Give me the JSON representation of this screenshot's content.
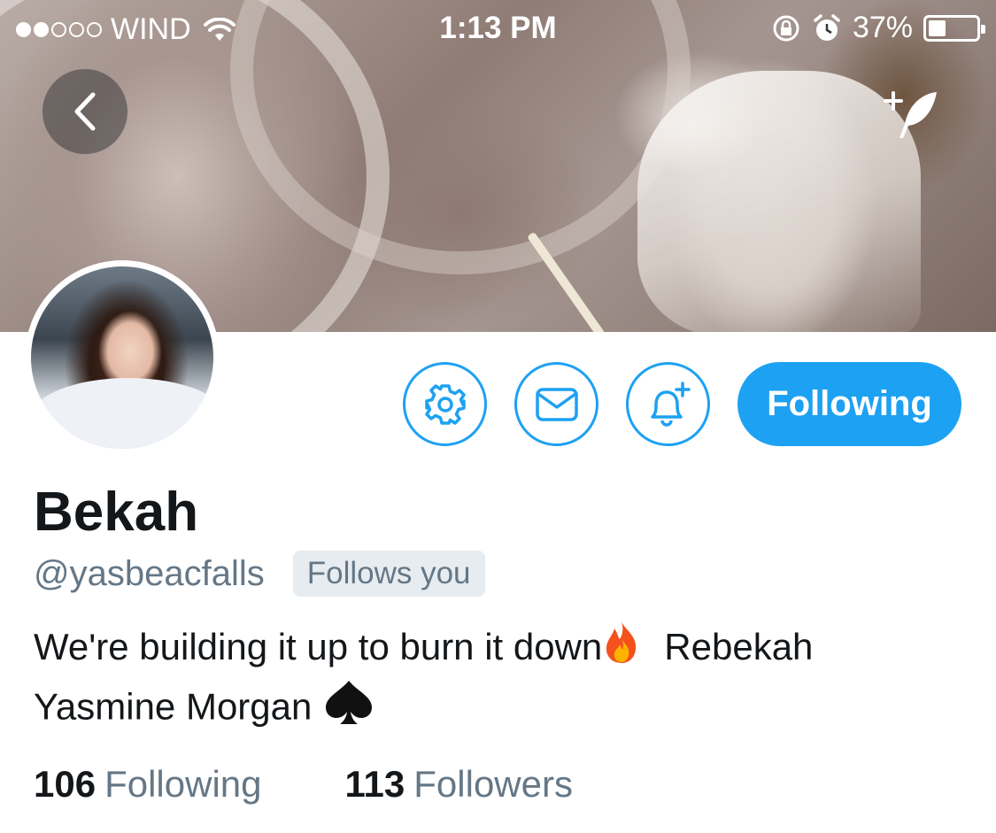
{
  "status_bar": {
    "carrier": "WIND",
    "time": "1:13 PM",
    "battery": "37%",
    "battery_level": 0.37,
    "signal_bars_filled": 2,
    "signal_bars_total": 5
  },
  "header": {
    "back_icon": "chevron-left-icon",
    "compose_icon": "compose-quill-icon"
  },
  "profile": {
    "name": "Bekah",
    "handle": "@yasbeacfalls",
    "follows_you": "Follows you",
    "bio_line1": "We're building it up to burn it down",
    "bio_line1_tail": "Rebekah",
    "bio_line2": "Yasmine Morgan",
    "bio_emojis": [
      "fire-emoji",
      "spade-emoji"
    ]
  },
  "actions": {
    "settings_icon": "gear-icon",
    "message_icon": "envelope-icon",
    "notify_icon": "bell-plus-icon",
    "follow_label": "Following"
  },
  "stats": {
    "following_count": "106",
    "following_label": "Following",
    "followers_count": "113",
    "followers_label": "Followers"
  },
  "colors": {
    "accent": "#1da1f2",
    "secondary_text": "#657786",
    "primary_text": "#14171a",
    "badge_bg": "#e6ecf0"
  }
}
